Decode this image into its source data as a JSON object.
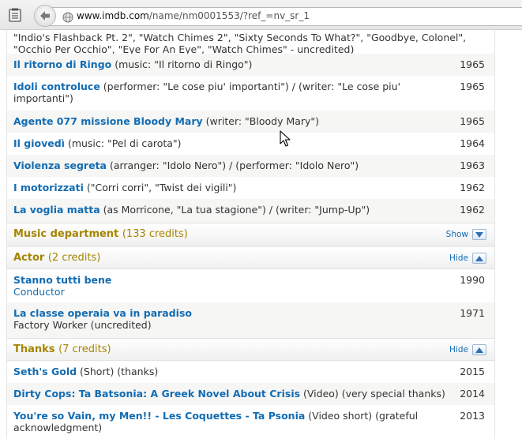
{
  "browser": {
    "url_domain": "www.imdb.com",
    "url_path": "/name/nm0001553/?ref_=nv_sr_1",
    "icons": [
      "menu-icon",
      "back-arrow-icon",
      "globe-icon"
    ]
  },
  "top_partial": {
    "line1": "\"Indio's Flashback Pt. 2\", \"Watch Chimes 2\", \"Sixty Seconds To What?\", \"Goodbye, Colonel\",",
    "line2": "\"Occhio Per Occhio\", \"Eye For An Eye\", \"Watch Chimes\" - uncredited)"
  },
  "soundtrack_rows": [
    {
      "title": "Il ritorno di Ringo",
      "desc": " (music: \"Il ritorno di Ringo\")",
      "year": "1965"
    },
    {
      "title": "Idoli controluce",
      "desc": " (performer: \"Le cose piu' importanti\") / (writer: \"Le cose piu' importanti\")",
      "year": "1965"
    },
    {
      "title": "Agente 077 missione Bloody Mary",
      "desc": " (writer: \"Bloody Mary\")",
      "year": "1965"
    },
    {
      "title": "Il giovedì",
      "desc": " (music: \"Pel di carota\")",
      "year": "1964"
    },
    {
      "title": "Violenza segreta",
      "desc": " (arranger: \"Idolo Nero\") / (performer: \"Idolo Nero\")",
      "year": "1963"
    },
    {
      "title": "I motorizzati",
      "desc": " (\"Corri corri\", \"Twist dei vigili\")",
      "year": "1962"
    },
    {
      "title": "La voglia matta",
      "desc": " (as Morricone, \"La tua stagione\") / (writer: \"Jump-Up\")",
      "year": "1962"
    }
  ],
  "sections": {
    "music_department": {
      "title": "Music department",
      "count": "(133 credits)",
      "toggle": "Show"
    },
    "actor": {
      "title": "Actor",
      "count": "(2 credits)",
      "toggle": "Hide"
    },
    "thanks": {
      "title": "Thanks",
      "count": "(7 credits)",
      "toggle": "Hide"
    }
  },
  "actor_rows": [
    {
      "title": "Stanno tutti bene",
      "role": "Conductor",
      "year": "1990"
    },
    {
      "title": "La classe operaia va in paradiso",
      "role": "Factory Worker (uncredited)",
      "year": "1971"
    }
  ],
  "thanks_rows": [
    {
      "title": "Seth's Gold",
      "desc": " (Short) (thanks)",
      "year": "2015"
    },
    {
      "title": "Dirty Cops: Ta Batsonia: A Greek Novel About Crisis",
      "desc": " (Video) (very special thanks)",
      "year": "2014"
    },
    {
      "title": "You're so Vain, my Men!! - Les Coquettes - Ta Psonia",
      "desc": " (Video short) (grateful acknowledgment)",
      "year": "2013"
    }
  ]
}
